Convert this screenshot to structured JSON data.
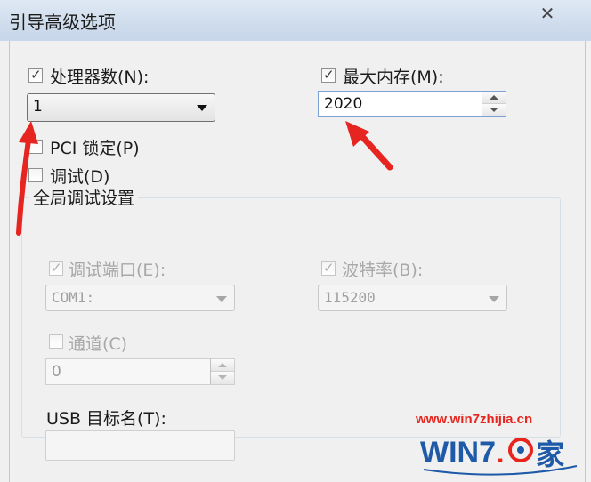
{
  "window": {
    "title": "引导高级选项",
    "close_glyph": "✕"
  },
  "processors": {
    "label": "处理器数(N):",
    "checked": true,
    "value": "1"
  },
  "max_memory": {
    "label": "最大内存(M):",
    "checked": true,
    "value": "2020"
  },
  "pci_lock": {
    "label": "PCI 锁定(P)",
    "checked": false
  },
  "debug": {
    "label": "调试(D)",
    "checked": false
  },
  "global_debug": {
    "title": "全局调试设置",
    "debug_port": {
      "label": "调试端口(E):",
      "checked": true,
      "enabled": false,
      "value": "COM1:"
    },
    "baud_rate": {
      "label": "波特率(B):",
      "checked": true,
      "enabled": false,
      "value": "115200"
    },
    "channel": {
      "label": "通道(C)",
      "checked": false,
      "enabled": false,
      "value": "0"
    },
    "usb_target": {
      "label": "USB 目标名(T):",
      "value": ""
    }
  },
  "watermark": {
    "url": "www.win7zhijia.cn",
    "logo_text": "WIN7",
    "logo_suffix": "家",
    "brand_red": "#e8251d",
    "brand_blue": "#1e5aa8"
  },
  "annotations": {
    "arrow_color": "#e62420"
  }
}
